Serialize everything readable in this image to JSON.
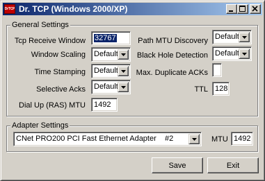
{
  "window": {
    "title": "Dr. TCP (Windows 2000/XP)",
    "icon_text": "DrTCP"
  },
  "general": {
    "label": "General Settings",
    "tcp_receive_window": {
      "label": "Tcp Receive Window",
      "value": "32767"
    },
    "window_scaling": {
      "label": "Window Scaling",
      "value": "Default"
    },
    "time_stamping": {
      "label": "Time Stamping",
      "value": "Default"
    },
    "selective_acks": {
      "label": "Selective Acks",
      "value": "Default"
    },
    "dialup_mtu": {
      "label": "Dial Up (RAS) MTU",
      "value": "1492"
    },
    "path_mtu_discovery": {
      "label": "Path MTU Discovery",
      "value": "Default"
    },
    "black_hole_detection": {
      "label": "Black Hole Detection",
      "value": "Default"
    },
    "max_duplicate_acks": {
      "label": "Max. Duplicate ACKs",
      "value": ""
    },
    "ttl": {
      "label": "TTL",
      "value": "128"
    }
  },
  "adapter": {
    "label": "Adapter Settings",
    "selected": "CNet PRO200 PCI Fast Ethernet Adapter    #2",
    "mtu_label": "MTU",
    "mtu_value": "1492"
  },
  "buttons": {
    "save": "Save",
    "exit": "Exit"
  },
  "colors": {
    "title_gradient_start": "#0a246a",
    "title_gradient_end": "#a6caf0",
    "face": "#d4d0c8",
    "selection": "#0a246a"
  }
}
